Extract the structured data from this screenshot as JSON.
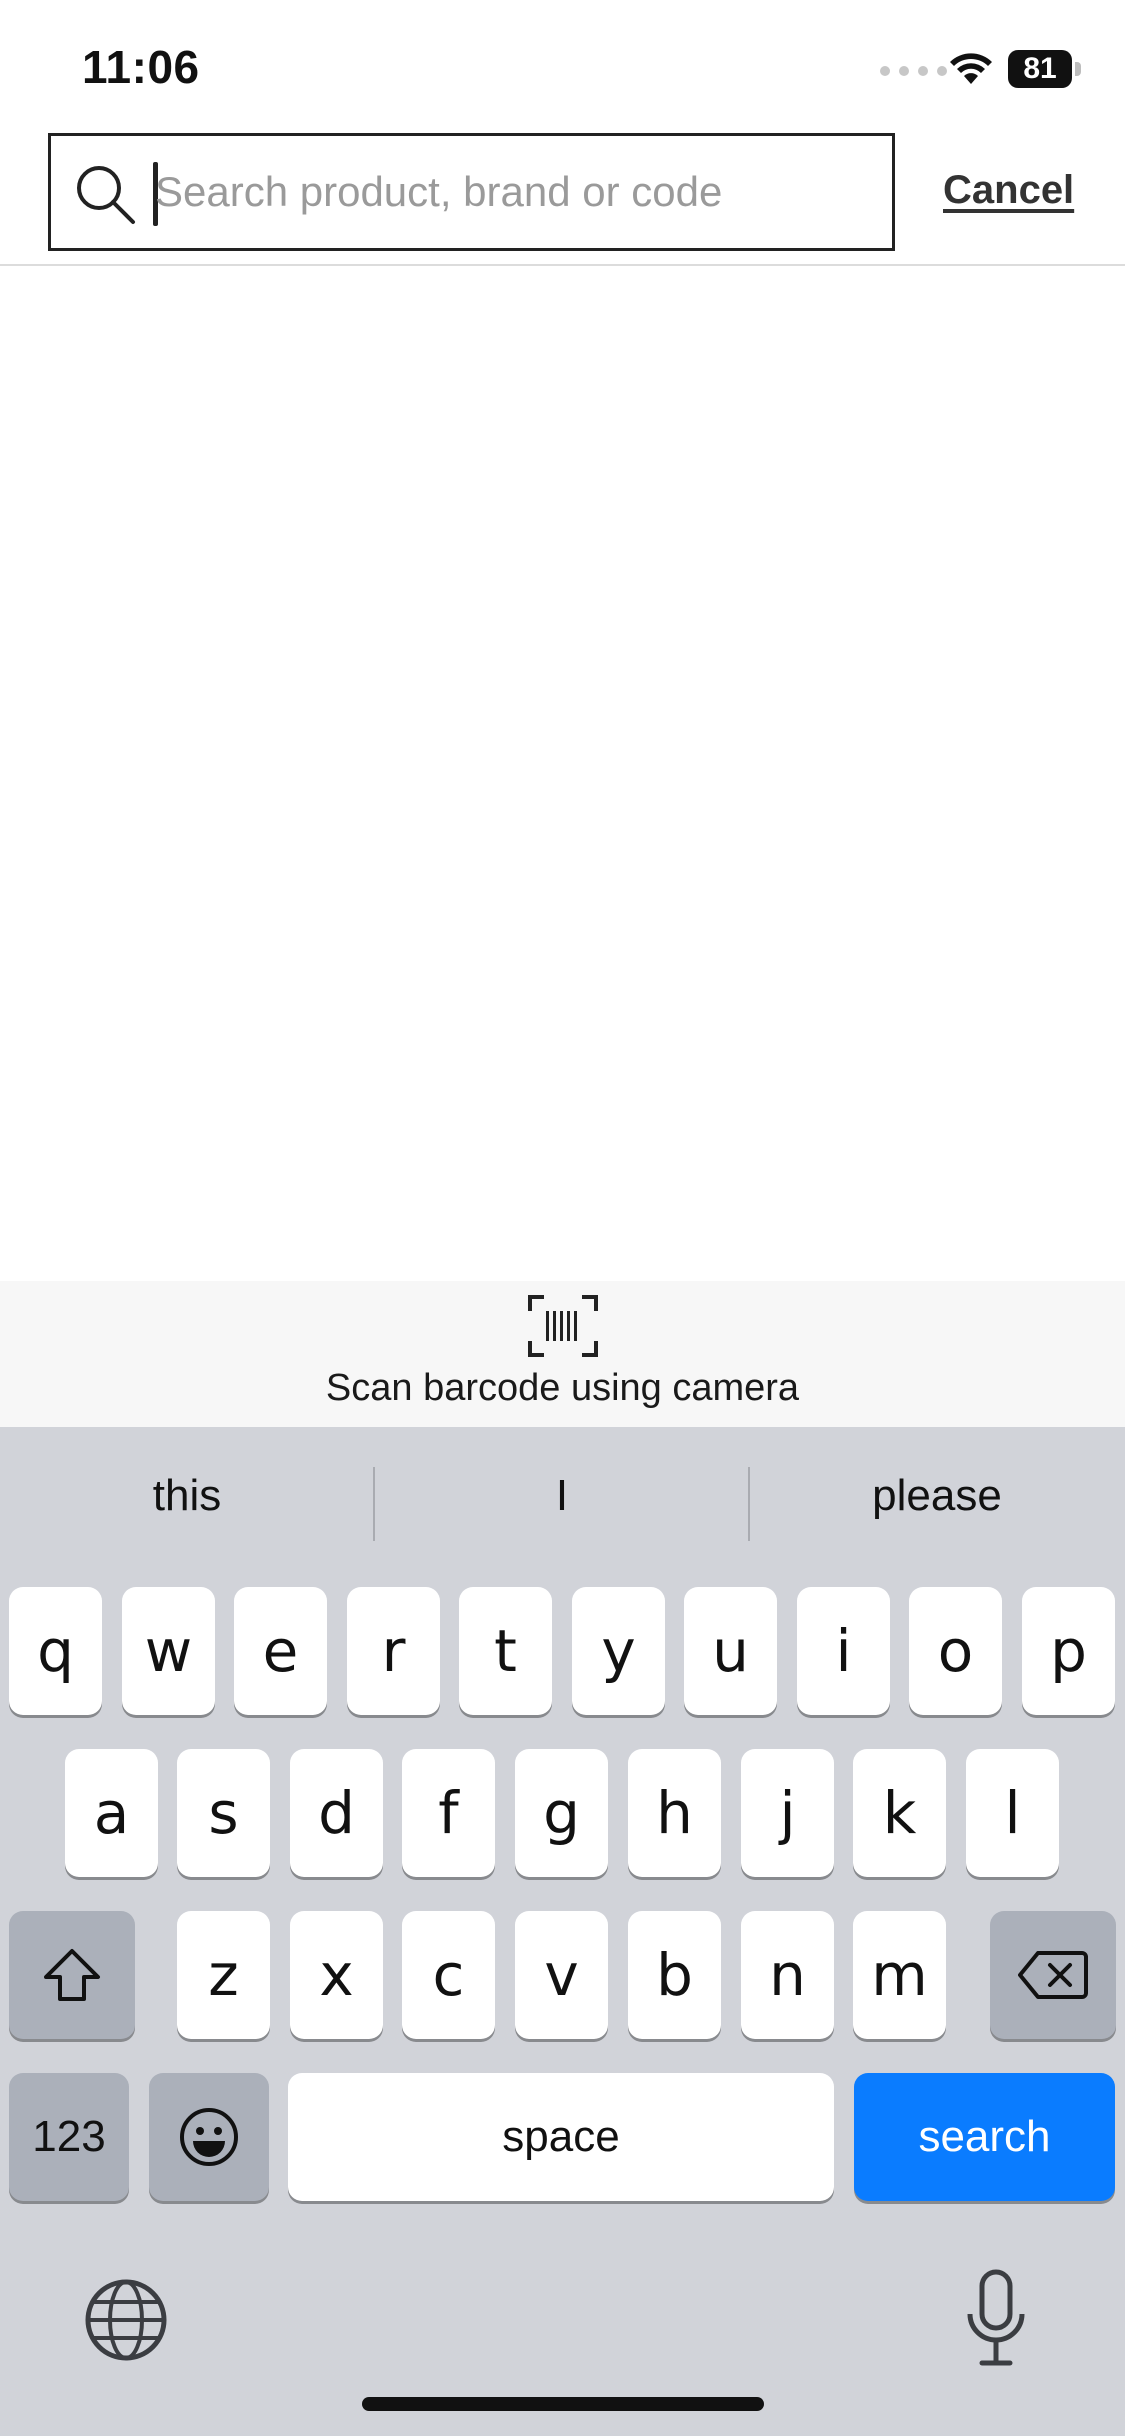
{
  "status_bar": {
    "time": "11:06",
    "battery": "81"
  },
  "search": {
    "placeholder": "Search product, brand or code",
    "value": "",
    "cancel_label": "Cancel"
  },
  "scan": {
    "label": "Scan barcode using camera"
  },
  "keyboard": {
    "suggestions": [
      "this",
      "I",
      "please"
    ],
    "row1": [
      "q",
      "w",
      "e",
      "r",
      "t",
      "y",
      "u",
      "i",
      "o",
      "p"
    ],
    "row2": [
      "a",
      "s",
      "d",
      "f",
      "g",
      "h",
      "j",
      "k",
      "l"
    ],
    "row3": [
      "z",
      "x",
      "c",
      "v",
      "b",
      "n",
      "m"
    ],
    "numbers_label": "123",
    "space_label": "space",
    "search_label": "search"
  },
  "colors": {
    "search_key": "#0a7cff",
    "keyboard_bg": "#d1d3d9"
  },
  "icons": [
    "search-icon",
    "barcode-icon",
    "shift-icon",
    "delete-icon",
    "emoji-icon",
    "globe-icon",
    "mic-icon",
    "wifi-icon",
    "battery-icon"
  ]
}
